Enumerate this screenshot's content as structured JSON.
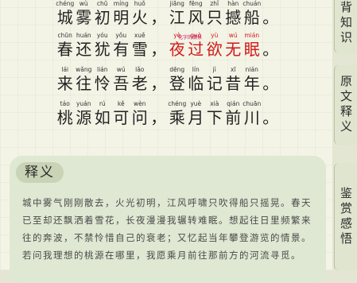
{
  "poem": {
    "lines": [
      {
        "chars": [
          {
            "py": "chéng",
            "hz": "城"
          },
          {
            "py": "wù",
            "hz": "雾"
          },
          {
            "py": "chū",
            "hz": "初"
          },
          {
            "py": "míng",
            "hz": "明"
          },
          {
            "py": "huǒ",
            "hz": "火"
          },
          {
            "py": "",
            "hz": "，"
          },
          {
            "py": "jiāng",
            "hz": "江"
          },
          {
            "py": "fēng",
            "hz": "风"
          },
          {
            "py": "zhǐ",
            "hz": "只"
          },
          {
            "py": "hàn",
            "hz": "撼"
          },
          {
            "py": "chuán",
            "hz": "船"
          },
          {
            "py": "",
            "hz": "。"
          }
        ]
      },
      {
        "chars": [
          {
            "py": "chūn",
            "hz": "春"
          },
          {
            "py": "huán",
            "hz": "还"
          },
          {
            "py": "yóu",
            "hz": "犹"
          },
          {
            "py": "yǒu",
            "hz": "有"
          },
          {
            "py": "xuě",
            "hz": "雪"
          },
          {
            "py": "",
            "hz": "，"
          },
          {
            "py": "yè",
            "hz": "夜",
            "red": true
          },
          {
            "py": "guò",
            "hz": "过",
            "red": true
          },
          {
            "py": "yù",
            "hz": "欲",
            "red": true
          },
          {
            "py": "wú",
            "hz": "无",
            "red": true
          },
          {
            "py": "mián",
            "hz": "眠",
            "red": true
          },
          {
            "py": "",
            "hz": "。"
          }
        ]
      },
      {
        "chars": [
          {
            "py": "lái",
            "hz": "来"
          },
          {
            "py": "wǎng",
            "hz": "往"
          },
          {
            "py": "lián",
            "hz": "怜"
          },
          {
            "py": "wú",
            "hz": "吾"
          },
          {
            "py": "lǎo",
            "hz": "老"
          },
          {
            "py": "",
            "hz": "，"
          },
          {
            "py": "dēng",
            "hz": "登"
          },
          {
            "py": "lín",
            "hz": "临"
          },
          {
            "py": "jì",
            "hz": "记"
          },
          {
            "py": "xī",
            "hz": "昔"
          },
          {
            "py": "nián",
            "hz": "年"
          },
          {
            "py": "",
            "hz": "。"
          }
        ]
      },
      {
        "chars": [
          {
            "py": "táo",
            "hz": "桃"
          },
          {
            "py": "yuán",
            "hz": "源"
          },
          {
            "py": "rú",
            "hz": "如"
          },
          {
            "py": "kě",
            "hz": "可"
          },
          {
            "py": "wèn",
            "hz": "问"
          },
          {
            "py": "",
            "hz": "，"
          },
          {
            "py": "chéng",
            "hz": "乘"
          },
          {
            "py": "yuè",
            "hz": "月"
          },
          {
            "py": "xià",
            "hz": "下"
          },
          {
            "py": "qián",
            "hz": "前"
          },
          {
            "py": "chuān",
            "hz": "川"
          },
          {
            "py": "",
            "hz": "。"
          }
        ]
      }
    ],
    "annotation": "化字的情景"
  },
  "section": {
    "title": "释义",
    "text": "城中雾气刚刚散去，火光初明，江风呼啸只吹得船只摇晃。春天已至却还飘洒着雪花，长夜漫漫我辗转难眠。想起往日里频繁来往的奔波，不禁怜惜自己的衰老；又忆起当年攀登游览的情景。若问我理想的桃源在哪里，我愿乘月前往那前方的河流寻觅。"
  },
  "tabs": [
    {
      "label": "背知识"
    },
    {
      "label": "原文释义"
    },
    {
      "label": "鉴赏感悟"
    }
  ]
}
